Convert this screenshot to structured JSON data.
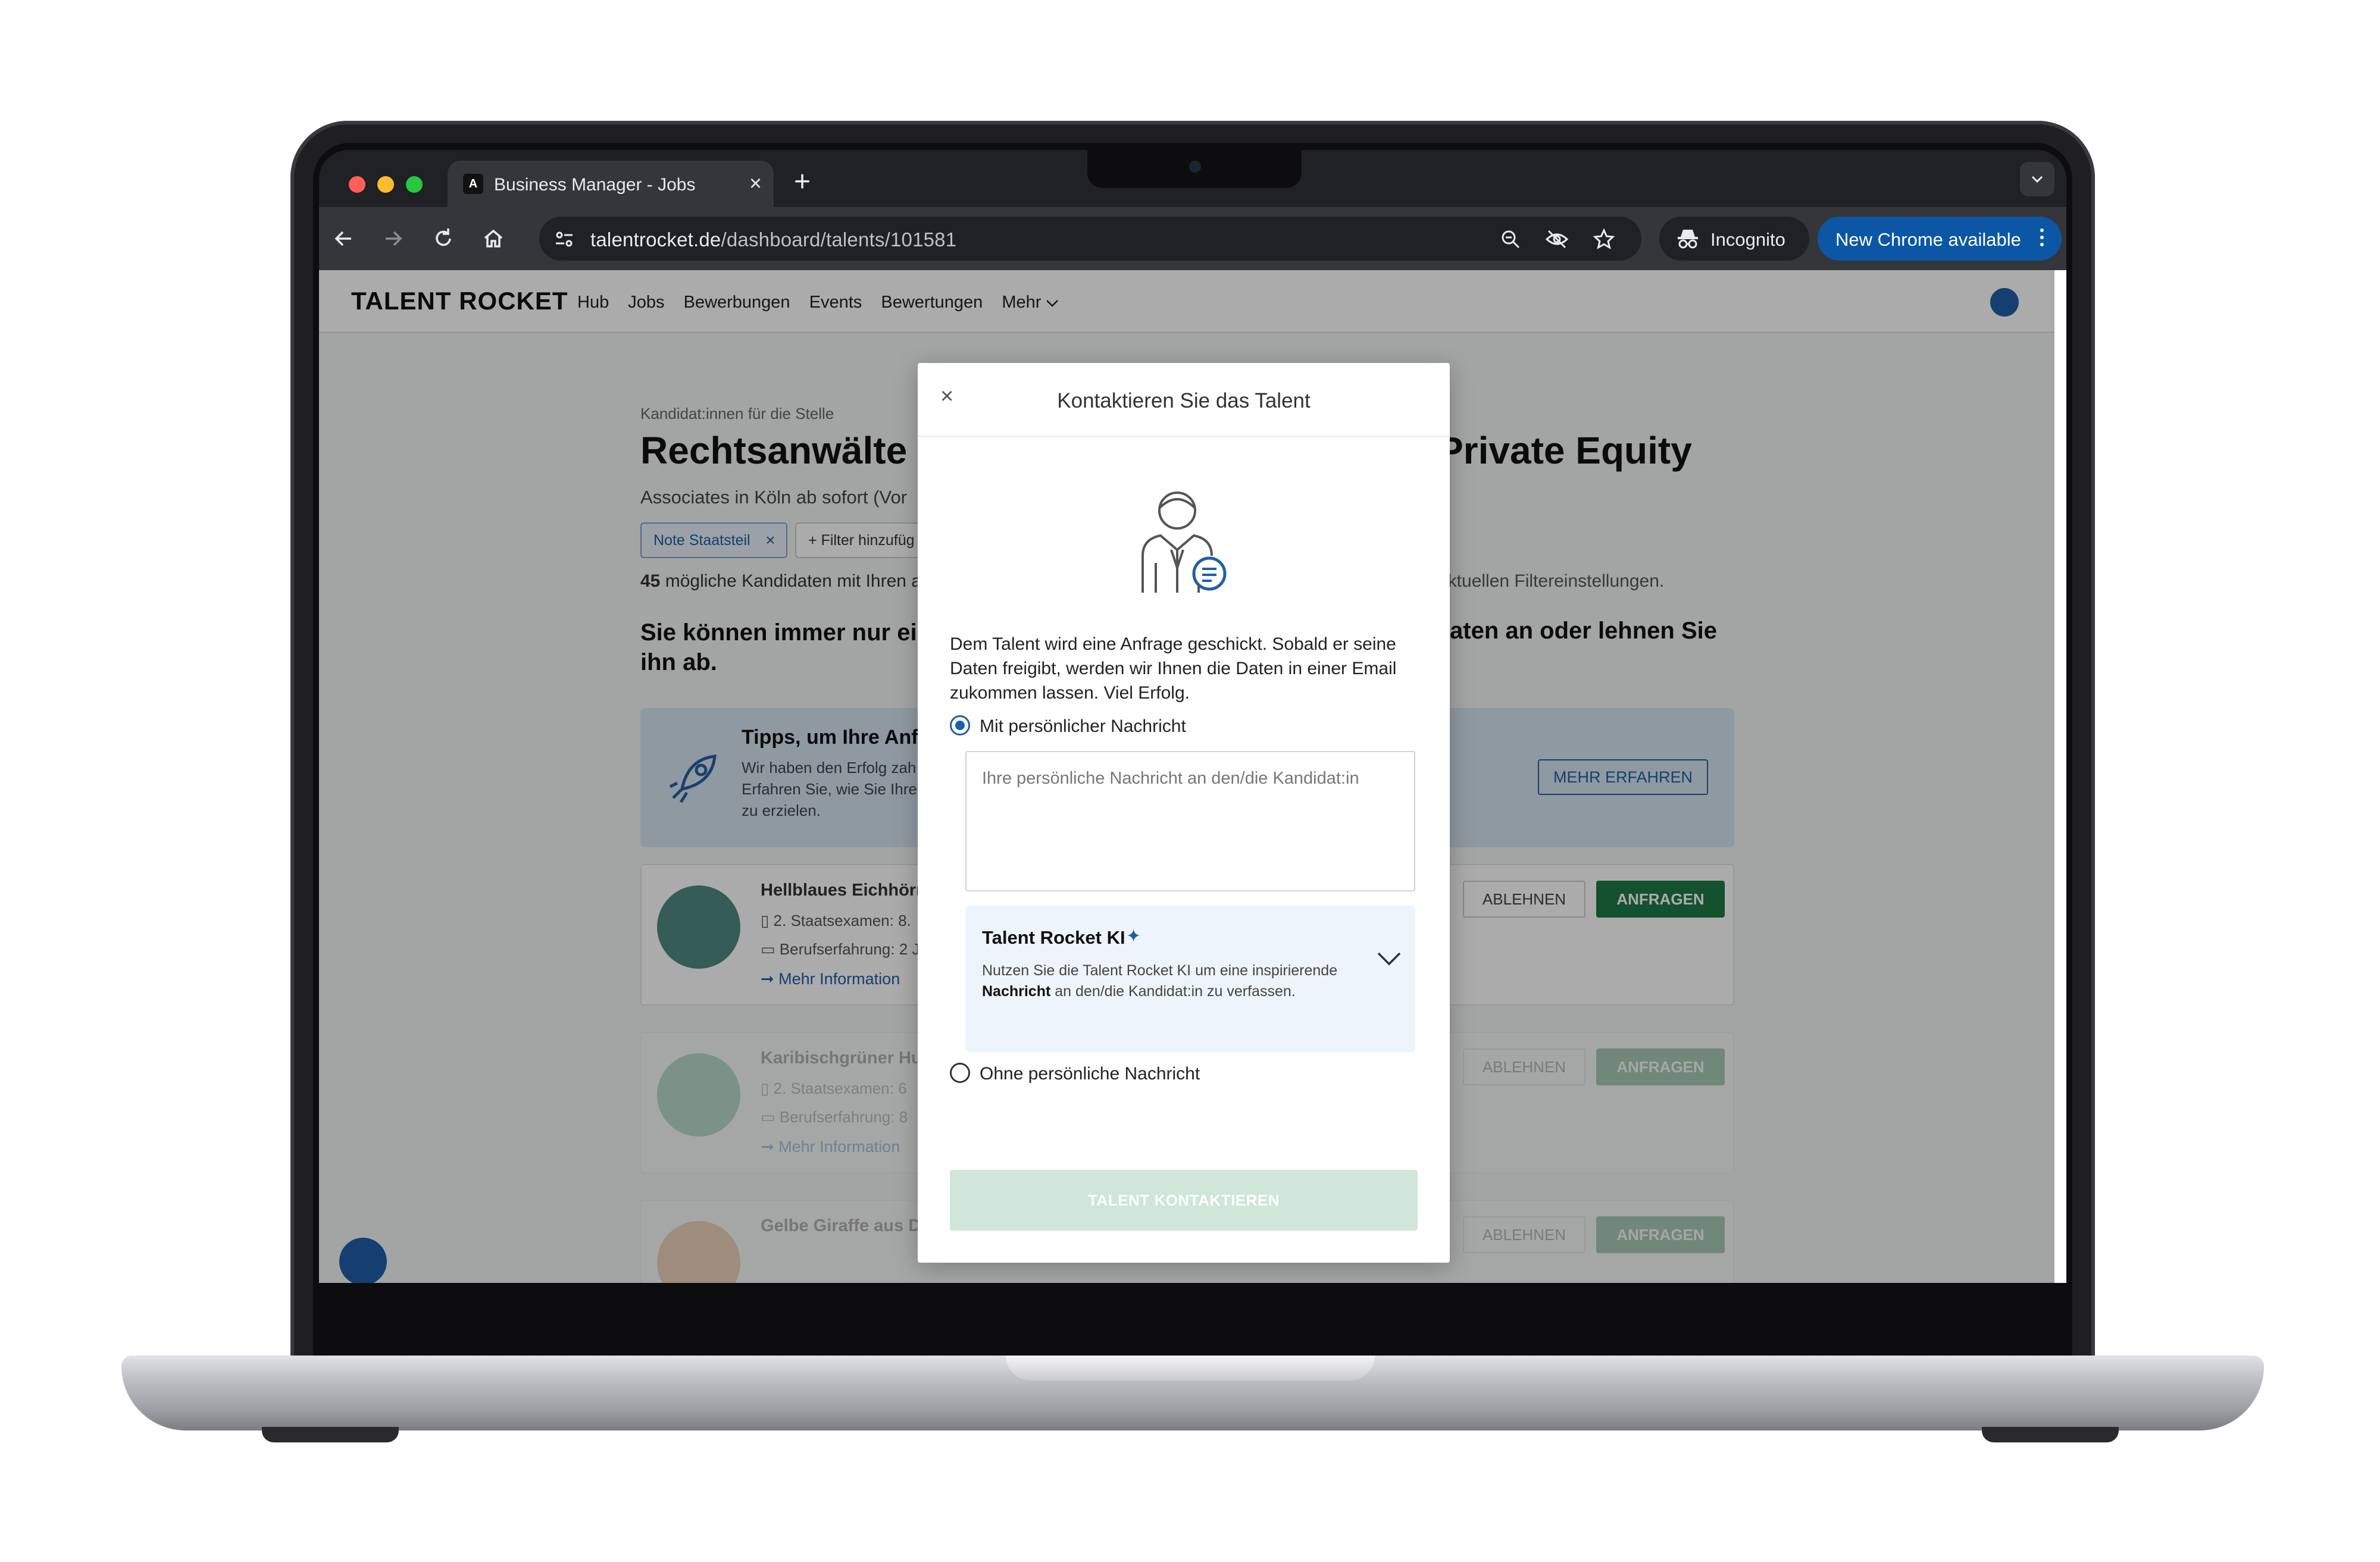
{
  "browser": {
    "tab_title": "Business Manager - Jobs",
    "tab_favicon": "A",
    "url_host": "talentrocket.de",
    "url_path": "/dashboard/talents/101581",
    "incognito_label": "Incognito",
    "update_label": "New Chrome available"
  },
  "site": {
    "logo": "TALENT ROCKET",
    "nav": [
      "Hub",
      "Jobs",
      "Bewerbungen",
      "Events",
      "Bewertungen",
      "Mehr"
    ]
  },
  "background": {
    "caption": "Kandidat:innen für die Stelle",
    "title_left": "Rechtsanwälte",
    "title_right": "Private Equity",
    "subtitle": "Associates in Köln ab sofort  (Vor",
    "filter_chip": "Note Staatsteil",
    "add_filter": "+  Filter hinzufüg",
    "count_number": "45",
    "count_text_left": " mögliche Kandidaten mit Ihren a",
    "count_text_right": "aktuellen Filtereinstellungen.",
    "hint_left": "Sie können immer nur eine ihn ab.",
    "hint_right": "aten an oder lehnen Sie",
    "tips_title": "Tipps, um Ihre Anfra",
    "tips_body": "Wir haben den Erfolg zah Erfahren Sie, wie Sie Ihre zu erzielen.",
    "tips_button": "MEHR ERFAHREN",
    "candidates": [
      {
        "name": "Hellblaues Eichhörn",
        "exam": "2. Staatsexamen: 8.",
        "experience": "Berufserfahrung: 2 J",
        "link": "➞ Mehr Information",
        "decline": "ABLEHNEN",
        "request": "ANFRAGEN"
      },
      {
        "name": "Karibischgrüner Hun",
        "exam": "2. Staatsexamen: 6",
        "experience": "Berufserfahrung: 8",
        "link": "➞ Mehr Information",
        "decline": "ABLEHNEN",
        "request": "ANFRAGEN"
      },
      {
        "name": "Gelbe Giraffe aus Düsseldorf",
        "exam": "",
        "experience": "",
        "link": "",
        "decline": "ABLEHNEN",
        "request": "ANFRAGEN"
      }
    ]
  },
  "modal": {
    "close": "×",
    "title": "Kontaktieren Sie das Talent",
    "description": "Dem Talent wird eine Anfrage geschickt. Sobald er seine Daten freigibt, werden wir Ihnen die Daten in einer Email zukommen lassen. Viel Erfolg.",
    "option_with": "Mit persönlicher Nachricht",
    "message_placeholder": "Ihre persönliche Nachricht an den/die Kandidat:in",
    "message_value": "",
    "ki_title": "Talent Rocket KI",
    "ki_body_before": "Nutzen Sie die Talent Rocket KI um eine inspirierende ",
    "ki_body_bold": "Nachricht",
    "ki_body_after": " an den/die Kandidat:in zu verfassen.",
    "option_without": "Ohne persönliche Nachricht",
    "cta": "TALENT KONTAKTIEREN",
    "selected_option": "with"
  },
  "colors": {
    "primary_blue": "#1f5fa8",
    "request_green": "#1f7a45",
    "cta_disabled": "#cfe6d9",
    "chrome_update": "#0b57a6"
  }
}
